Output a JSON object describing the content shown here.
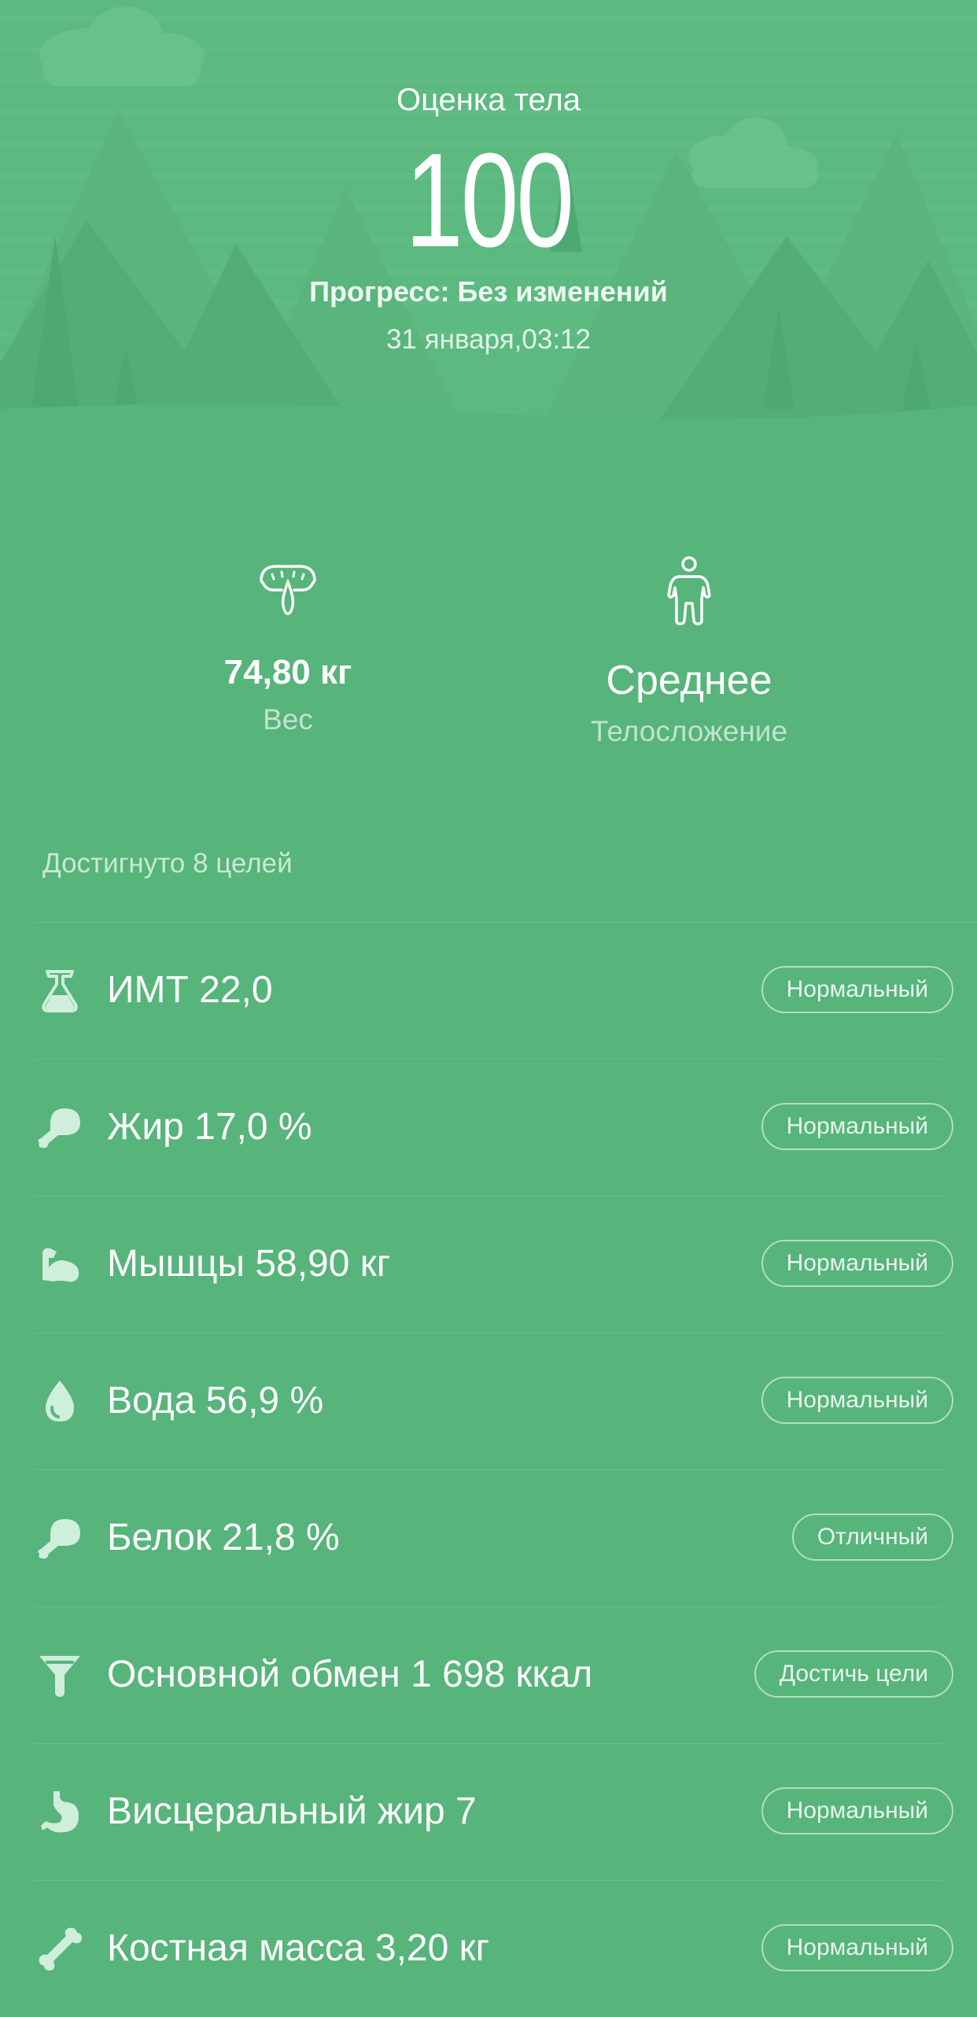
{
  "colors": {
    "background": "#57b47b",
    "hero_light": "#63be85",
    "hero_mid": "#5bb87f",
    "icon": "#cfeedb"
  },
  "hero": {
    "title": "Оценка тела",
    "score": "100",
    "progress": "Прогресс: Без изменений",
    "date": "31 января,03:12"
  },
  "stats": {
    "weight": {
      "value": "74,80 кг",
      "label": "Вес",
      "icon": "scale-icon"
    },
    "build": {
      "value": "Среднее",
      "label": "Телосложение",
      "icon": "body-figure-icon"
    }
  },
  "goals_title": "Достигнуто 8 целей",
  "metrics": [
    {
      "icon": "bmi-flask-icon",
      "text": "ИМТ 22,0",
      "badge": "Нормальный"
    },
    {
      "icon": "fat-drumstick-icon",
      "text": "Жир 17,0 %",
      "badge": "Нормальный"
    },
    {
      "icon": "muscle-arm-icon",
      "text": "Мышцы 58,90 кг",
      "badge": "Нормальный"
    },
    {
      "icon": "water-drop-icon",
      "text": "Вода 56,9 %",
      "badge": "Нормальный"
    },
    {
      "icon": "protein-drumstick-icon",
      "text": "Белок 21,8 %",
      "badge": "Отличный"
    },
    {
      "icon": "metabolism-funnel-icon",
      "text": "Основной обмен 1 698 ккал",
      "badge": "Достичь цели"
    },
    {
      "icon": "stomach-icon",
      "text": "Висцеральный жир 7",
      "badge": "Нормальный"
    },
    {
      "icon": "bone-icon",
      "text": "Костная масса 3,20 кг",
      "badge": "Нормальный"
    }
  ]
}
